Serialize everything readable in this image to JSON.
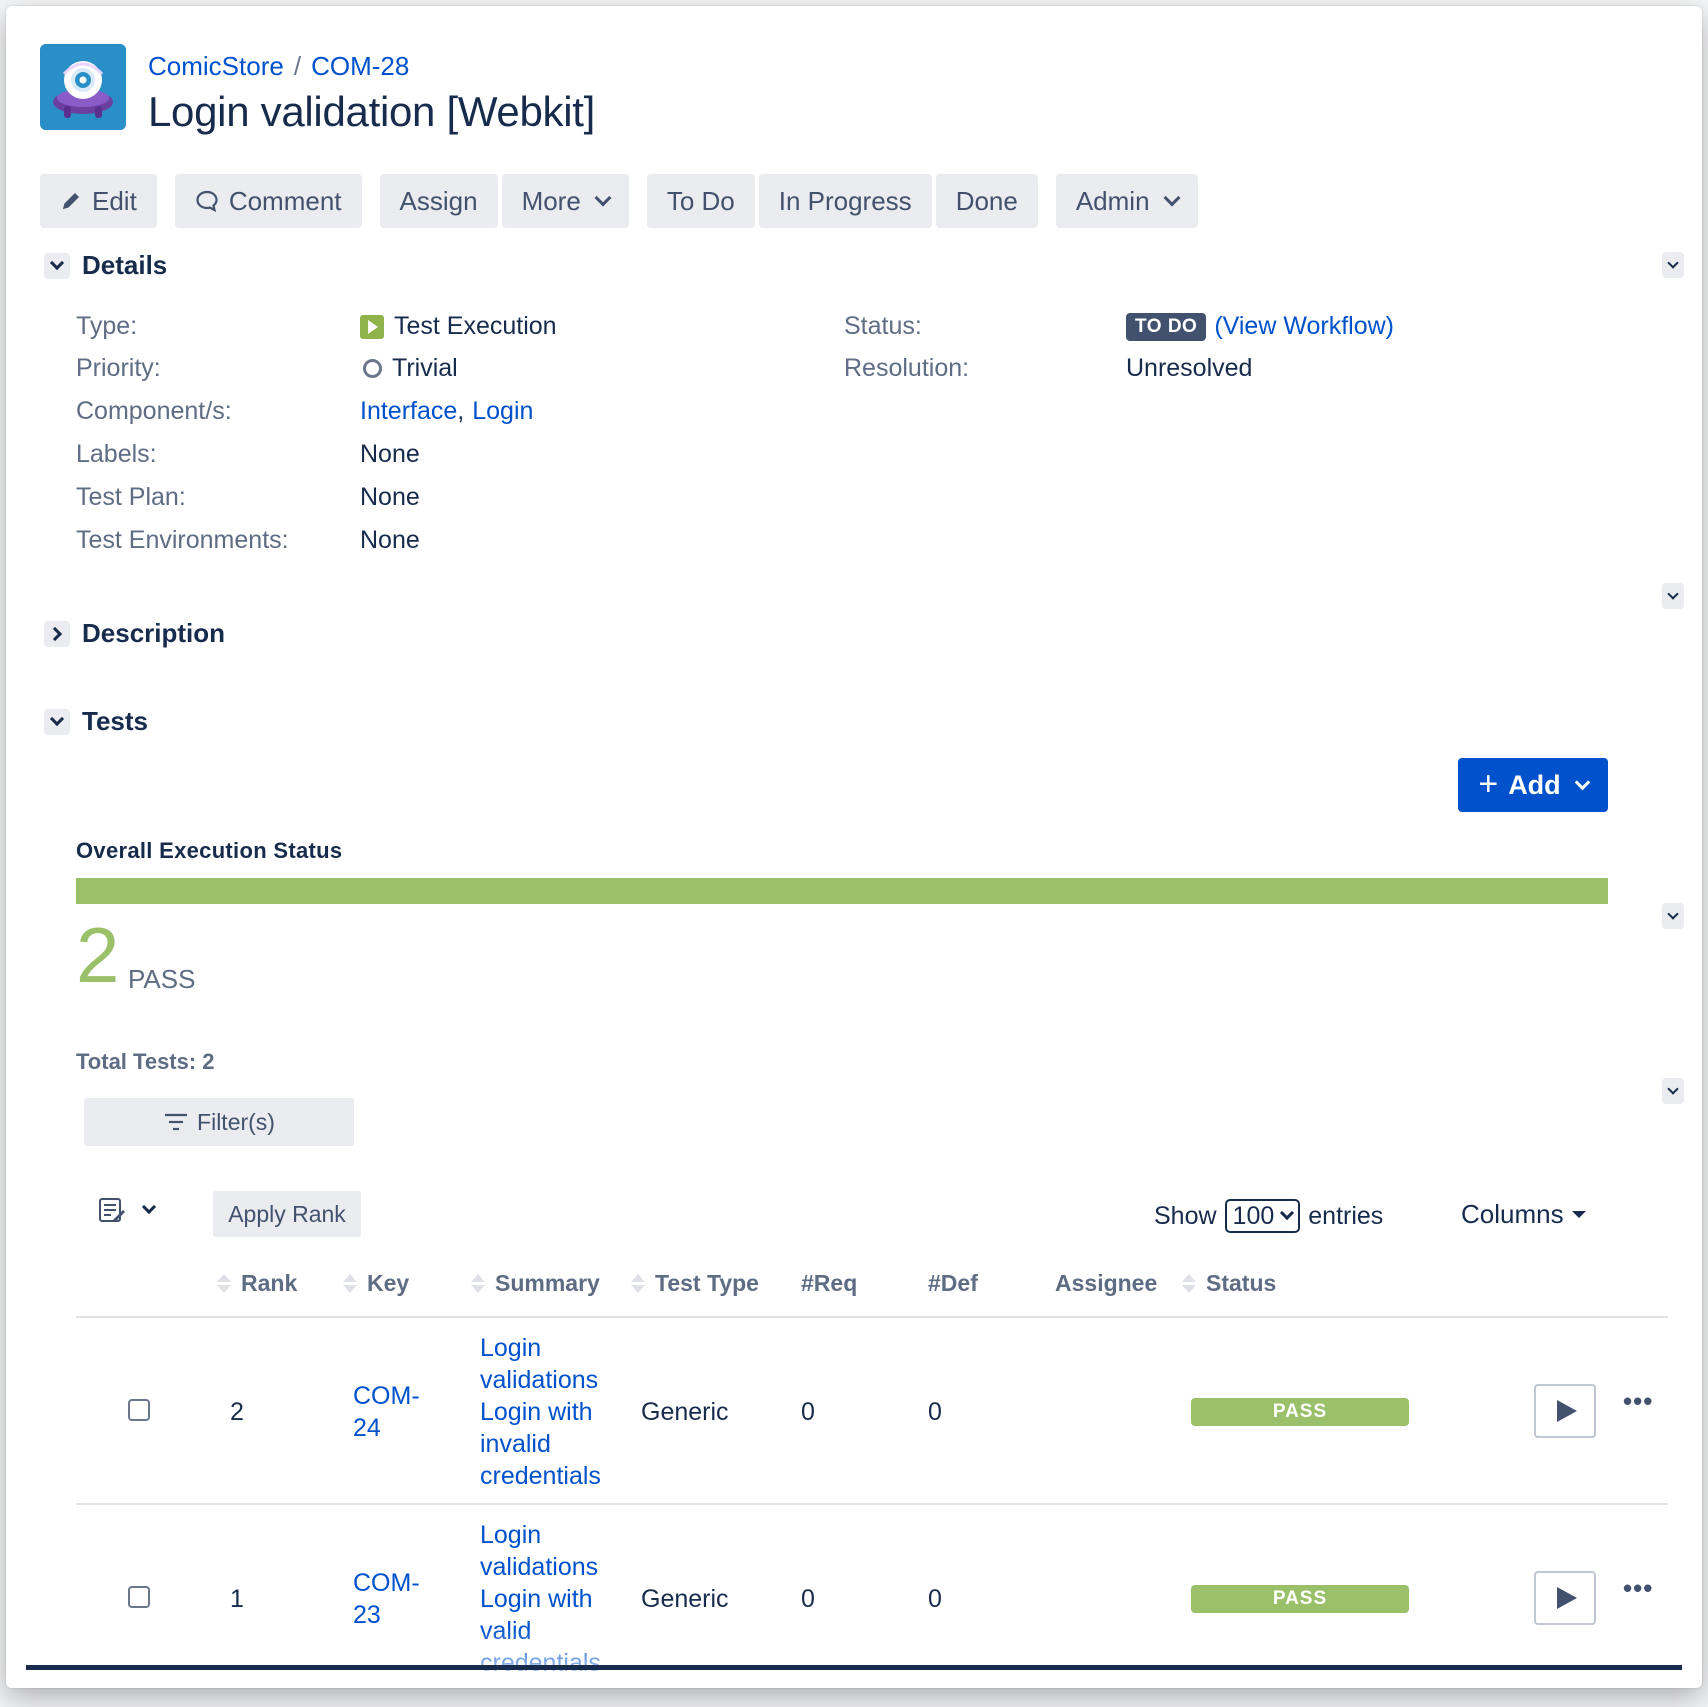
{
  "header": {
    "breadcrumb": {
      "project": "ComicStore",
      "separator": "/",
      "issue_key": "COM-28"
    },
    "title": "Login validation [Webkit]"
  },
  "toolbar": {
    "edit": "Edit",
    "comment": "Comment",
    "assign": "Assign",
    "more": "More",
    "todo": "To Do",
    "in_progress": "In Progress",
    "done": "Done",
    "admin": "Admin"
  },
  "details": {
    "heading": "Details",
    "type_label": "Type:",
    "type_value": "Test Execution",
    "priority_label": "Priority:",
    "priority_value": "Trivial",
    "components_label": "Component/s:",
    "component_1": "Interface",
    "component_sep": ",",
    "component_2": "Login",
    "labels_label": "Labels:",
    "labels_value": "None",
    "test_plan_label": "Test Plan:",
    "test_plan_value": "None",
    "test_env_label": "Test Environments:",
    "test_env_value": "None",
    "status_label": "Status:",
    "status_value": "TO DO",
    "view_workflow_open": "(",
    "view_workflow": "View Workflow",
    "view_workflow_close": ")",
    "resolution_label": "Resolution:",
    "resolution_value": "Unresolved"
  },
  "description": {
    "heading": "Description"
  },
  "tests": {
    "heading": "Tests",
    "add_label": "Add",
    "overall_title": "Overall Execution Status",
    "pass_fraction": 1.0,
    "pass_count": "2",
    "pass_label": "PASS",
    "total_tests": "Total Tests: 2",
    "filter_label": "Filter(s)",
    "apply_rank": "Apply Rank",
    "show_label": "Show",
    "entries_value": "100",
    "entries_label": "entries",
    "columns_label": "Columns",
    "headers": {
      "rank": "Rank",
      "key": "Key",
      "summary": "Summary",
      "test_type": "Test Type",
      "req": "#Req",
      "def": "#Def",
      "assignee": "Assignee",
      "status": "Status"
    },
    "rows": [
      {
        "rank": "2",
        "key_line1": "COM-",
        "key_line2": "24",
        "summary_lines": [
          "Login",
          "validations",
          "Login with",
          "invalid",
          "credentials"
        ],
        "test_type": "Generic",
        "req": "0",
        "def": "0",
        "status": "PASS"
      },
      {
        "rank": "1",
        "key_line1": "COM-",
        "key_line2": "23",
        "summary_lines": [
          "Login",
          "validations",
          "Login with",
          "valid",
          "credentials"
        ],
        "test_type": "Generic",
        "req": "0",
        "def": "0",
        "status": "PASS"
      }
    ],
    "more_dots": "•••"
  },
  "colors": {
    "link": "#0052cc",
    "pass": "#9bc06a",
    "primary": "#0052cc",
    "todo_lozenge": "#42526e"
  },
  "icons": [
    "project-avatar-icon",
    "pencil-icon",
    "comment-icon",
    "chevron-down-icon",
    "test-execution-icon",
    "trivial-priority-icon",
    "filter-icon",
    "rank-list-icon",
    "play-icon",
    "more-icon"
  ]
}
